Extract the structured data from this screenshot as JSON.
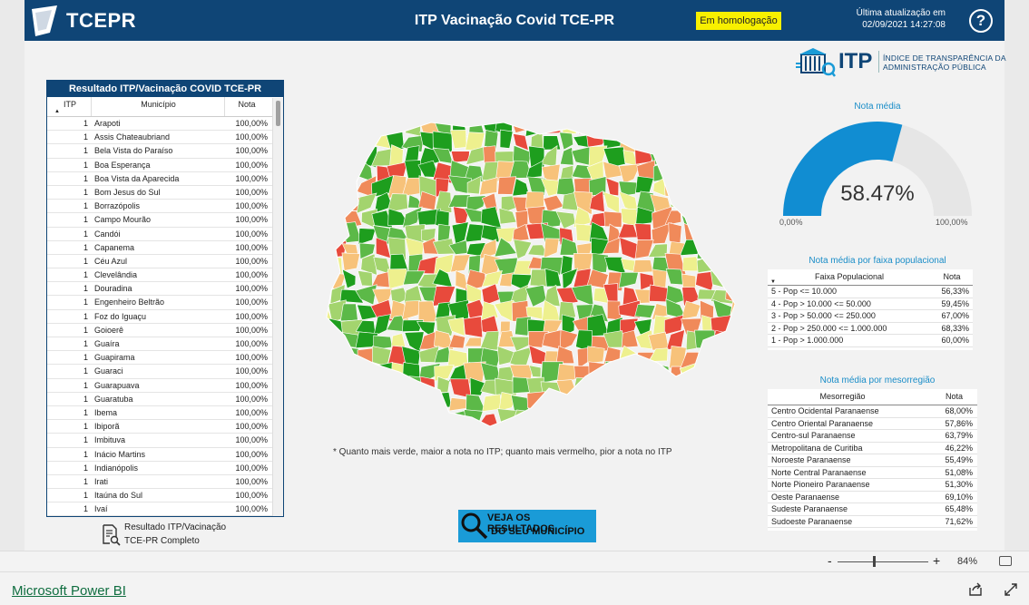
{
  "header": {
    "brand": "TCEPR",
    "title": "ITP Vacinação Covid TCE-PR",
    "env_badge": "Em homologação",
    "update_label": "Última atualização em",
    "update_time": "02/09/2021 14:27:08",
    "help_icon": "help-icon"
  },
  "itp_logo": {
    "text": "ITP",
    "subtitle_line1": "ÍNDICE DE TRANSPARÊNCIA DA",
    "subtitle_line2": "ADMINISTRAÇÃO PÚBLICA"
  },
  "results_table": {
    "title": "Resultado ITP/Vacinação COVID TCE-PR",
    "columns": [
      "ITP",
      "Município",
      "Nota"
    ],
    "rows": [
      {
        "itp": "1",
        "municipio": "Arapoti",
        "nota": "100,00%"
      },
      {
        "itp": "1",
        "municipio": "Assis Chateaubriand",
        "nota": "100,00%"
      },
      {
        "itp": "1",
        "municipio": "Bela Vista do Paraíso",
        "nota": "100,00%"
      },
      {
        "itp": "1",
        "municipio": "Boa Esperança",
        "nota": "100,00%"
      },
      {
        "itp": "1",
        "municipio": "Boa Vista da Aparecida",
        "nota": "100,00%"
      },
      {
        "itp": "1",
        "municipio": "Bom Jesus do Sul",
        "nota": "100,00%"
      },
      {
        "itp": "1",
        "municipio": "Borrazópolis",
        "nota": "100,00%"
      },
      {
        "itp": "1",
        "municipio": "Campo Mourão",
        "nota": "100,00%"
      },
      {
        "itp": "1",
        "municipio": "Candói",
        "nota": "100,00%"
      },
      {
        "itp": "1",
        "municipio": "Capanema",
        "nota": "100,00%"
      },
      {
        "itp": "1",
        "municipio": "Céu Azul",
        "nota": "100,00%"
      },
      {
        "itp": "1",
        "municipio": "Clevelândia",
        "nota": "100,00%"
      },
      {
        "itp": "1",
        "municipio": "Douradina",
        "nota": "100,00%"
      },
      {
        "itp": "1",
        "municipio": "Engenheiro Beltrão",
        "nota": "100,00%"
      },
      {
        "itp": "1",
        "municipio": "Foz do Iguaçu",
        "nota": "100,00%"
      },
      {
        "itp": "1",
        "municipio": "Goioerê",
        "nota": "100,00%"
      },
      {
        "itp": "1",
        "municipio": "Guaíra",
        "nota": "100,00%"
      },
      {
        "itp": "1",
        "municipio": "Guapirama",
        "nota": "100,00%"
      },
      {
        "itp": "1",
        "municipio": "Guaraci",
        "nota": "100,00%"
      },
      {
        "itp": "1",
        "municipio": "Guarapuava",
        "nota": "100,00%"
      },
      {
        "itp": "1",
        "municipio": "Guaratuba",
        "nota": "100,00%"
      },
      {
        "itp": "1",
        "municipio": "Ibema",
        "nota": "100,00%"
      },
      {
        "itp": "1",
        "municipio": "Ibiporã",
        "nota": "100,00%"
      },
      {
        "itp": "1",
        "municipio": "Imbituva",
        "nota": "100,00%"
      },
      {
        "itp": "1",
        "municipio": "Inácio Martins",
        "nota": "100,00%"
      },
      {
        "itp": "1",
        "municipio": "Indianópolis",
        "nota": "100,00%"
      },
      {
        "itp": "1",
        "municipio": "Irati",
        "nota": "100,00%"
      },
      {
        "itp": "1",
        "municipio": "Itaúna do Sul",
        "nota": "100,00%"
      },
      {
        "itp": "1",
        "municipio": "Ivaí",
        "nota": "100,00%"
      }
    ]
  },
  "full_report_link": {
    "line1": "Resultado ITP/Vacinação",
    "line2": "TCE-PR Completo",
    "icon": "report-search-icon"
  },
  "map": {
    "note": "* Quanto mais verde, maior a nota no ITP; quanto mais vermelho, pior a nota no ITP",
    "colors": [
      "#1e9e1e",
      "#5cb948",
      "#a3d46e",
      "#eef08e",
      "#f7c27a",
      "#f08a5a",
      "#e84a3c"
    ]
  },
  "cta_button": {
    "line1": "VEJA OS RESULTADOS",
    "line2": "DO SEU MUNICÍPIO",
    "icon": "magnifier-icon"
  },
  "gauge": {
    "title": "Nota média",
    "value": 58.47,
    "value_label": "58.47%",
    "min_label": "0,00%",
    "max_label": "100,00%",
    "fill_color": "#118dd2",
    "track_color": "#e6e6e6"
  },
  "faixa_table": {
    "title": "Nota média por faixa populacional",
    "columns": [
      "Faixa Populacional",
      "Nota"
    ],
    "rows": [
      {
        "label": "5 - Pop <= 10.000",
        "nota": "56,33%"
      },
      {
        "label": "4 - Pop > 10.000 <= 50.000",
        "nota": "59,45%"
      },
      {
        "label": "3 - Pop > 50.000 <= 250.000",
        "nota": "67,00%"
      },
      {
        "label": "2 - Pop > 250.000 <= 1.000.000",
        "nota": "68,33%"
      },
      {
        "label": "1 - Pop > 1.000.000",
        "nota": "60,00%"
      }
    ]
  },
  "meso_table": {
    "title": "Nota média por mesorregião",
    "columns": [
      "Mesorregião",
      "Nota"
    ],
    "rows": [
      {
        "label": "Centro Ocidental Paranaense",
        "nota": "68,00%"
      },
      {
        "label": "Centro Oriental Paranaense",
        "nota": "57,86%"
      },
      {
        "label": "Centro-sul Paranaense",
        "nota": "63,79%"
      },
      {
        "label": "Metropolitana de Curitiba",
        "nota": "46,22%"
      },
      {
        "label": "Noroeste Paranaense",
        "nota": "55,49%"
      },
      {
        "label": "Norte Central Paranaense",
        "nota": "51,08%"
      },
      {
        "label": "Norte Pioneiro Paranaense",
        "nota": "51,30%"
      },
      {
        "label": "Oeste Paranaense",
        "nota": "69,10%"
      },
      {
        "label": "Sudeste Paranaense",
        "nota": "65,48%"
      },
      {
        "label": "Sudoeste Paranaense",
        "nota": "71,62%"
      }
    ]
  },
  "zoom": {
    "minus": "-",
    "plus": "+",
    "level": "84%",
    "slider_value": 84
  },
  "footer": {
    "link": "Microsoft Power BI",
    "share_icon": "share-icon",
    "expand_icon": "expand-icon"
  }
}
